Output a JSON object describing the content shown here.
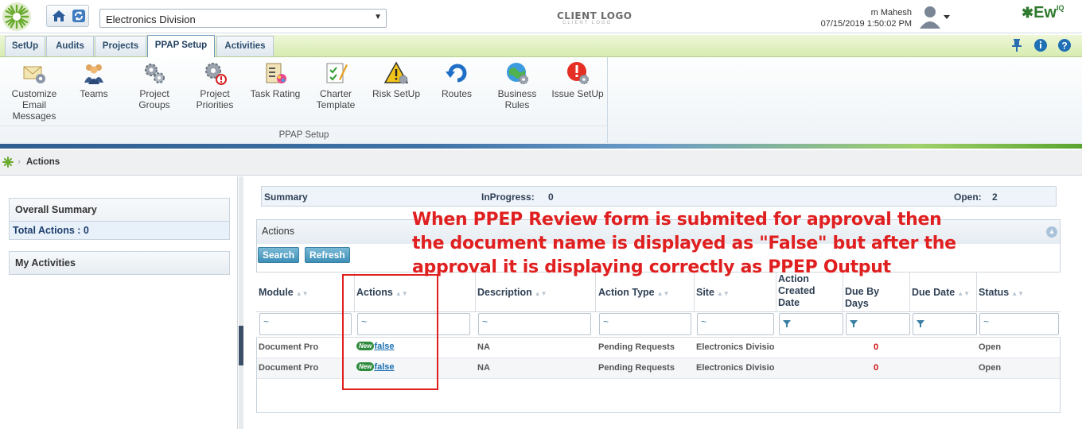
{
  "header": {
    "division": "Electronics Division",
    "client_logo": "CLIENT LOGO",
    "client_logo_sub": "CLIENT LOGO",
    "user": "m Mahesh",
    "datetime": "07/15/2019 1:50:02 PM",
    "brand": "Ew"
  },
  "tabs": [
    "SetUp",
    "Audits",
    "Projects",
    "PPAP Setup",
    "Activities"
  ],
  "active_tab": "PPAP Setup",
  "ribbon": {
    "group_label": "PPAP Setup",
    "items": [
      {
        "label": "Customize Email Messages",
        "icon": "email-settings-icon"
      },
      {
        "label": "Teams",
        "icon": "team-icon"
      },
      {
        "label": "Project Groups",
        "icon": "gears-icon"
      },
      {
        "label": "Project Priorities",
        "icon": "priority-gear-icon"
      },
      {
        "label": "Task Rating",
        "icon": "task-rating-icon"
      },
      {
        "label": "Charter Template",
        "icon": "charter-template-icon"
      },
      {
        "label": "Risk SetUp",
        "icon": "risk-warning-icon"
      },
      {
        "label": "Routes",
        "icon": "routes-icon"
      },
      {
        "label": "Business Rules",
        "icon": "business-rules-icon"
      },
      {
        "label": "Issue SetUp",
        "icon": "issue-alert-icon"
      }
    ]
  },
  "breadcrumb": "Actions",
  "left": {
    "overall_summary": "Overall Summary",
    "total_actions": "Total Actions : 0",
    "my_activities": "My Activities"
  },
  "summary": {
    "label": "Summary",
    "inprogress_label": "InProgress:",
    "inprogress_value": "0",
    "open_label": "Open:",
    "open_value": "2"
  },
  "actions_panel": {
    "title": "Actions",
    "search_label": "Search",
    "refresh_label": "Refresh",
    "columns": [
      "Module",
      "Actions",
      "Description",
      "Action Type",
      "Site",
      "Action Created Date",
      "Due By Days",
      "Due Date",
      "Status"
    ],
    "filter_placeholder": "~",
    "rows": [
      {
        "module": "Document Pro",
        "badge": "New",
        "action": "false",
        "description": "NA",
        "action_type": "Pending Requests",
        "site": "Electronics Divisio",
        "created": "",
        "due_by_days": "0",
        "due_date": "",
        "status": "Open"
      },
      {
        "module": "Document Pro",
        "badge": "New",
        "action": "false",
        "description": "NA",
        "action_type": "Pending Requests",
        "site": "Electronics Divisio",
        "created": "",
        "due_by_days": "0",
        "due_date": "",
        "status": "Open"
      }
    ]
  },
  "annotation": "When PPEP Review form is submited for approval then the document name is displayed as \"False\" but after the approval it is displaying correctly as PPEP Output",
  "colors": {
    "annotation": "#e02020",
    "accent": "#3e8fb7",
    "tabbar": "#d7ecb0"
  }
}
